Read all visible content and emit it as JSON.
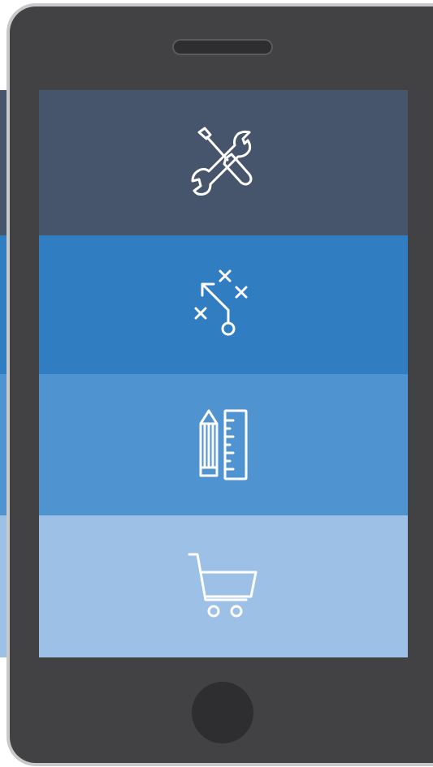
{
  "screen": {
    "tiles": [
      {
        "icon": "tools-wrench-screwdriver-icon",
        "color": "#46556b"
      },
      {
        "icon": "strategy-play-icon",
        "color": "#317dc2"
      },
      {
        "icon": "pencil-ruler-icon",
        "color": "#5093d1"
      },
      {
        "icon": "shopping-cart-icon",
        "color": "#9dc1e6"
      }
    ]
  },
  "background_strips": [
    "#46556b",
    "#317dc2",
    "#5093d1",
    "#9dc1e6"
  ],
  "device": {
    "frame_color": "#424244",
    "bezel_color": "#c9c9c9",
    "button_color": "#2e2e30"
  }
}
